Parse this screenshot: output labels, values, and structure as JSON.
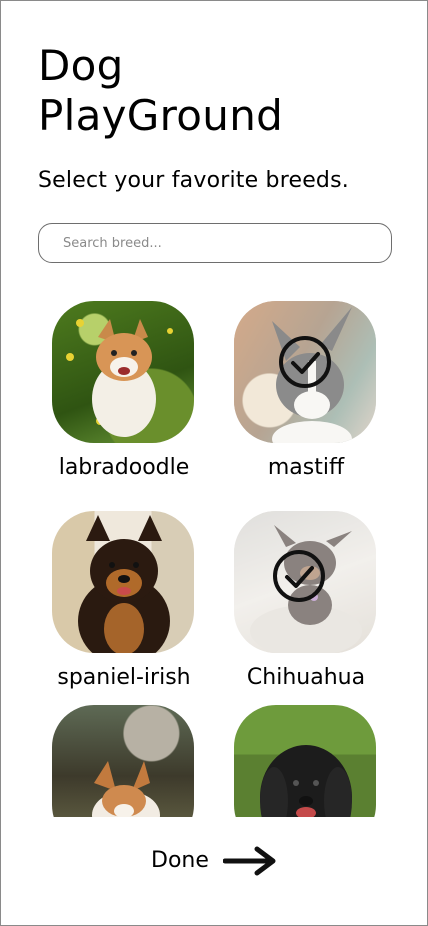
{
  "header": {
    "title": "Dog PlayGround",
    "subtitle": "Select your favorite breeds."
  },
  "search": {
    "placeholder": "Search breed..."
  },
  "breeds": [
    {
      "label": "labradoodle",
      "selected": false
    },
    {
      "label": "mastiff",
      "selected": true
    },
    {
      "label": "spaniel-irish",
      "selected": false
    },
    {
      "label": "Chihuahua",
      "selected": true
    },
    {
      "label": "",
      "selected": false
    },
    {
      "label": "",
      "selected": false
    }
  ],
  "footer": {
    "done_label": "Done",
    "done_icon": "arrow-right-icon"
  }
}
